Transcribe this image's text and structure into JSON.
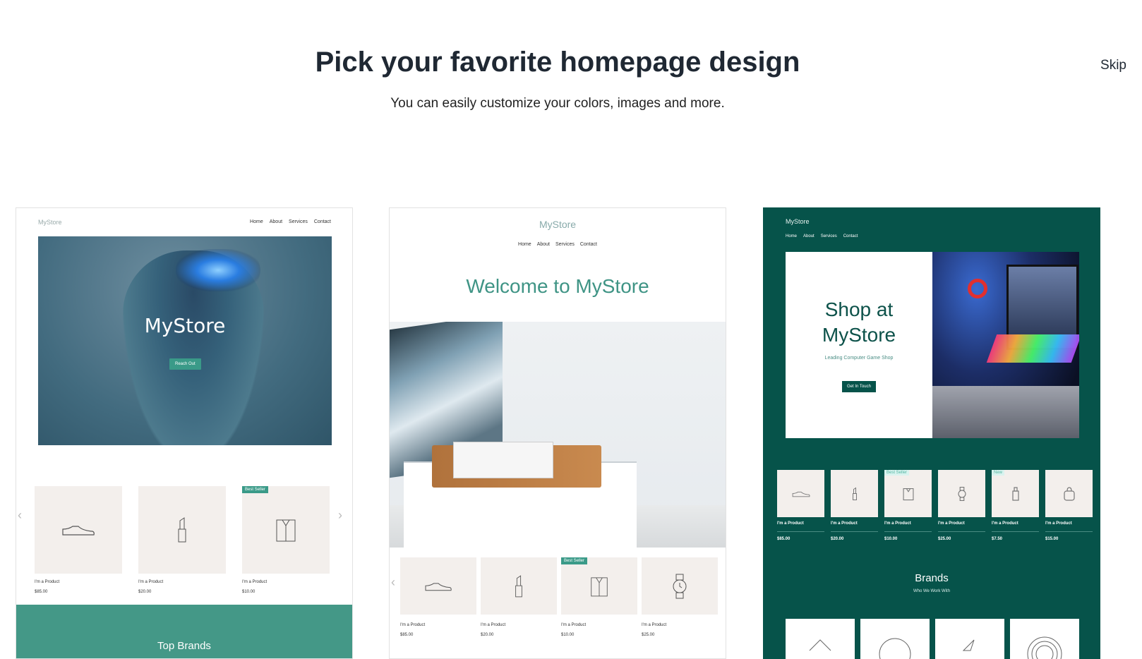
{
  "header": {
    "title": "Pick your favorite homepage design",
    "subtitle": "You can easily customize your colors, images and more.",
    "skip": "Skip"
  },
  "card1": {
    "logo": "MyStore",
    "nav": [
      "Home",
      "About",
      "Services",
      "Contact"
    ],
    "hero_title": "MyStore",
    "hero_button": "Reach Out",
    "badge": "Best Seller",
    "products": [
      {
        "name": "I'm a Product",
        "price": "$85.00",
        "icon": "shoe-icon"
      },
      {
        "name": "I'm a Product",
        "price": "$20.00",
        "icon": "lipstick-icon"
      },
      {
        "name": "I'm a Product",
        "price": "$10.00",
        "icon": "shirt-icon"
      }
    ],
    "band_title": "Top Brands"
  },
  "card2": {
    "logo": "MyStore",
    "nav": [
      "Home",
      "About",
      "Services",
      "Contact"
    ],
    "welcome": "Welcome to MyStore",
    "badge": "Best Seller",
    "products": [
      {
        "name": "I'm a Product",
        "price": "$85.00",
        "icon": "shoe-icon"
      },
      {
        "name": "I'm a Product",
        "price": "$20.00",
        "icon": "lipstick-icon"
      },
      {
        "name": "I'm a Product",
        "price": "$10.00",
        "icon": "shirt-icon"
      },
      {
        "name": "I'm a Product",
        "price": "$25.00",
        "icon": "watch-icon"
      }
    ]
  },
  "card3": {
    "logo": "MyStore",
    "nav": [
      "Home",
      "About",
      "Services",
      "Contact"
    ],
    "hero_title_1": "Shop at",
    "hero_title_2": "MyStore",
    "hero_sub": "Leading Computer Game Shop",
    "hero_button": "Get In Touch",
    "badge_best": "Best Seller",
    "badge_new": "New",
    "products": [
      {
        "name": "I'm a Product",
        "price": "$85.00",
        "icon": "shoe-icon"
      },
      {
        "name": "I'm a Product",
        "price": "$20.00",
        "icon": "lipstick-icon"
      },
      {
        "name": "I'm a Product",
        "price": "$10.00",
        "icon": "shirt-icon"
      },
      {
        "name": "I'm a Product",
        "price": "$25.00",
        "icon": "watch-icon"
      },
      {
        "name": "I'm a Product",
        "price": "$7.50",
        "icon": "bottle-icon"
      },
      {
        "name": "I'm a Product",
        "price": "$15.00",
        "icon": "bag-icon"
      }
    ],
    "brands_title": "Brands",
    "brands_sub": "Who We Work With"
  }
}
